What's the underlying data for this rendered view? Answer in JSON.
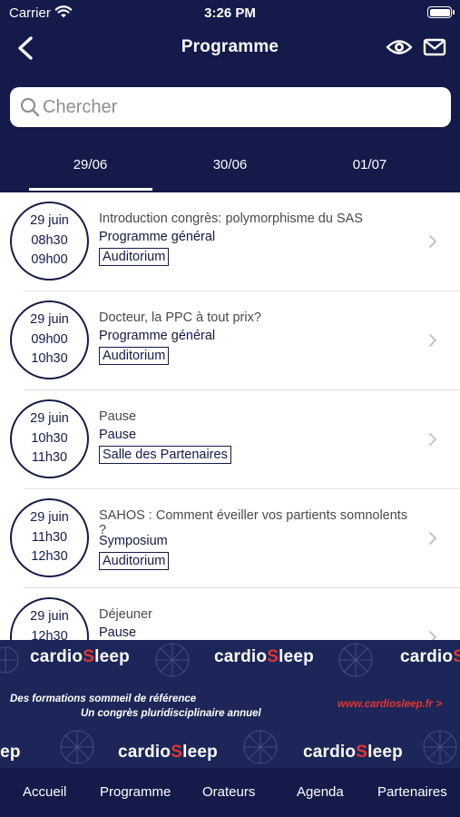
{
  "status_bar": {
    "carrier": "Carrier",
    "time": "3:26 PM"
  },
  "nav": {
    "title": "Programme"
  },
  "search": {
    "placeholder": "Chercher"
  },
  "day_tabs": [
    {
      "label": "29/06",
      "selected": true
    },
    {
      "label": "30/06",
      "selected": false
    },
    {
      "label": "01/07",
      "selected": false
    }
  ],
  "sessions": [
    {
      "date": "29 juin",
      "start": "08h30",
      "end": "09h00",
      "title": "Introduction congrès: polymorphisme du SAS",
      "category": "Programme général",
      "room": "Auditorium"
    },
    {
      "date": "29 juin",
      "start": "09h00",
      "end": "10h30",
      "title": "Docteur, la PPC à tout prix?",
      "category": "Programme général",
      "room": "Auditorium"
    },
    {
      "date": "29 juin",
      "start": "10h30",
      "end": "11h30",
      "title": "Pause",
      "category": "Pause",
      "room": "Salle des Partenaires"
    },
    {
      "date": "29 juin",
      "start": "11h30",
      "end": "12h30",
      "title": "SAHOS : Comment éveiller vos partients somnolents ?",
      "category": "Symposium",
      "room": "Auditorium"
    },
    {
      "date": "29 juin",
      "start": "12h30",
      "end": "",
      "title": "Déjeuner",
      "category": "Pause",
      "room": ""
    }
  ],
  "banner": {
    "brand_prefix": "cardio",
    "brand_s": "S",
    "brand_suffix": "leep",
    "line1": "Des formations sommeil de référence",
    "line2": "Un congrès pluridisciplinaire annuel",
    "url": "www.cardiosleep.fr >",
    "accent_color": "#e53530"
  },
  "tab_bar": [
    {
      "label": "Accueil"
    },
    {
      "label": "Programme"
    },
    {
      "label": "Orateurs"
    },
    {
      "label": "Agenda"
    },
    {
      "label": "Partenaires"
    }
  ],
  "colors": {
    "navy": "#141a4a",
    "banner": "#1c2658"
  }
}
